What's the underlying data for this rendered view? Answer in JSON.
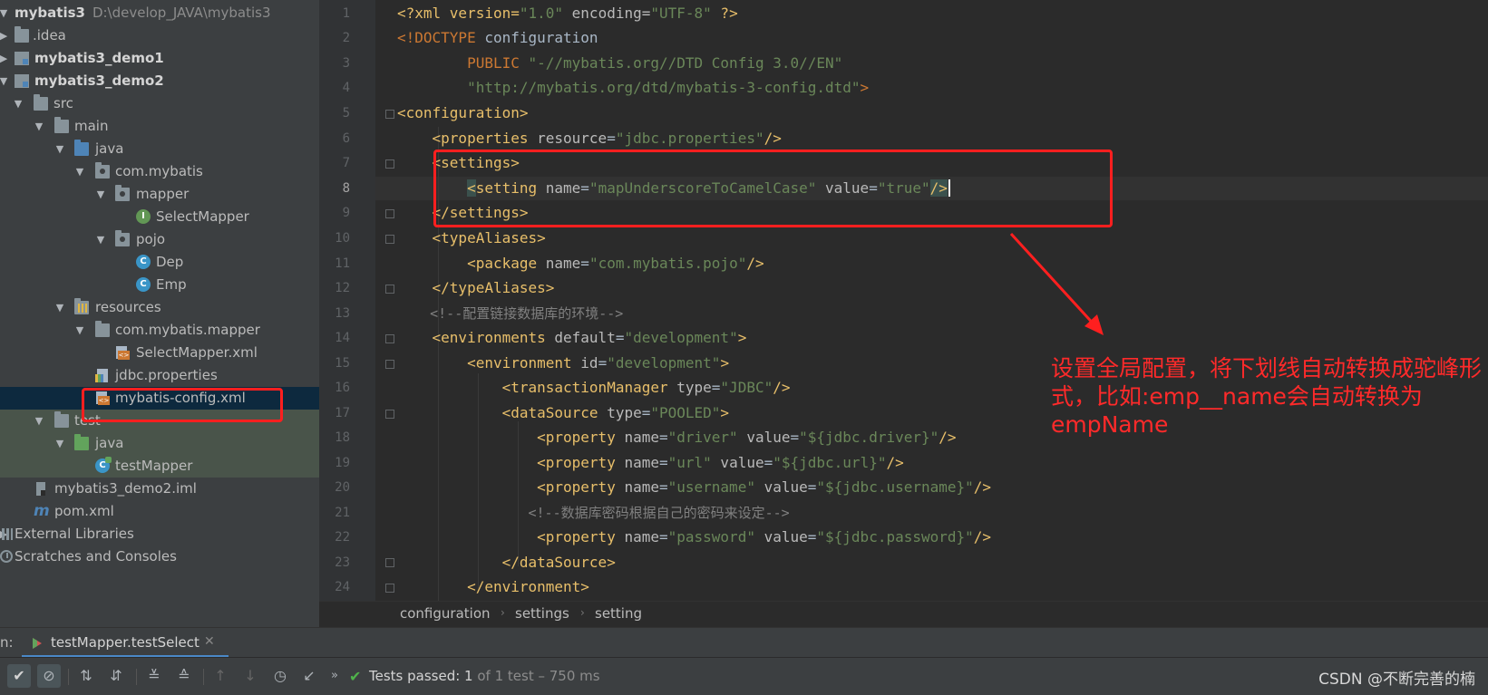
{
  "project_tree": {
    "root_name": "mybatis3",
    "root_path": "D:\\develop_JAVA\\mybatis3",
    "items": {
      "idea": ".idea",
      "demo1": "mybatis3_demo1",
      "demo2": "mybatis3_demo2",
      "src": "src",
      "main": "main",
      "java": "java",
      "com_mybatis": "com.mybatis",
      "mapper": "mapper",
      "select_mapper": "SelectMapper",
      "pojo": "pojo",
      "dep": "Dep",
      "emp": "Emp",
      "resources": "resources",
      "com_mybatis_mapper": "com.mybatis.mapper",
      "select_mapper_xml": "SelectMapper.xml",
      "jdbc_properties": "jdbc.properties",
      "mybatis_config": "mybatis-config.xml",
      "test": "test",
      "test_java": "java",
      "test_mapper": "testMapper",
      "iml": "mybatis3_demo2.iml",
      "pom": "pom.xml",
      "external_libraries": "External Libraries",
      "scratches": "Scratches and Consoles"
    }
  },
  "editor": {
    "line_numbers": [
      "1",
      "2",
      "3",
      "4",
      "5",
      "6",
      "7",
      "8",
      "9",
      "10",
      "11",
      "12",
      "13",
      "14",
      "15",
      "16",
      "17",
      "18",
      "19",
      "20",
      "21",
      "22",
      "23",
      "24"
    ],
    "current_line": "8",
    "lines": {
      "l1a": "<?xml version=",
      "l1b": "\"1.0\"",
      "l1c": " encoding=",
      "l1d": "\"UTF-8\"",
      "l1e": " ?>",
      "l2a": "<!DOCTYPE ",
      "l2b": "configuration",
      "l3a": "        PUBLIC ",
      "l3b": "\"-//mybatis.org//DTD Config 3.0//EN\"",
      "l4a": "        \"http://mybatis.org/dtd/mybatis-3-config.dtd\"",
      "l4b": ">",
      "l5": "<configuration>",
      "l6a": "    <properties ",
      "l6b": "resource",
      "l6c": "=",
      "l6d": "\"jdbc.properties\"",
      "l6e": "/>",
      "l7": "    <settings>",
      "l8a": "        ",
      "l8b": "<",
      "l8c": "setting ",
      "l8d": "name",
      "l8e": "=",
      "l8f": "\"mapUnderscoreToCamelCase\"",
      "l8g": " value",
      "l8h": "=",
      "l8i": "\"true\"",
      "l8j": "/>",
      "l9": "    </settings>",
      "l10": "    <typeAliases>",
      "l11a": "        <package ",
      "l11b": "name",
      "l11c": "=",
      "l11d": "\"com.mybatis.pojo\"",
      "l11e": "/>",
      "l12": "    </typeAliases>",
      "l13": "    <!--配置链接数据库的环境-->",
      "l14a": "    <environments ",
      "l14b": "default",
      "l14c": "=",
      "l14d": "\"development\"",
      "l14e": ">",
      "l15a": "        <environment ",
      "l15b": "id",
      "l15c": "=",
      "l15d": "\"development\"",
      "l15e": ">",
      "l16a": "            <transactionManager ",
      "l16b": "type",
      "l16c": "=",
      "l16d": "\"JDBC\"",
      "l16e": "/>",
      "l17a": "            <dataSource ",
      "l17b": "type",
      "l17c": "=",
      "l17d": "\"POOLED\"",
      "l17e": ">",
      "l18a": "                <property ",
      "l18b": "name",
      "l18c": "=",
      "l18d": "\"driver\"",
      "l18e": " value",
      "l18f": "=",
      "l18g": "\"${jdbc.driver}\"",
      "l18h": "/>",
      "l19a": "                <property ",
      "l19b": "name",
      "l19c": "=",
      "l19d": "\"url\"",
      "l19e": " value",
      "l19f": "=",
      "l19g": "\"${jdbc.url}\"",
      "l19h": "/>",
      "l20a": "                <property ",
      "l20b": "name",
      "l20c": "=",
      "l20d": "\"username\"",
      "l20e": " value",
      "l20f": "=",
      "l20g": "\"${jdbc.username}\"",
      "l20h": "/>",
      "l21": "                <!--数据库密码根据自己的密码来设定-->",
      "l22a": "                <property ",
      "l22b": "name",
      "l22c": "=",
      "l22d": "\"password\"",
      "l22e": " value",
      "l22f": "=",
      "l22g": "\"${jdbc.password}\"",
      "l22h": "/>",
      "l23": "            </dataSource>",
      "l24": "        </environment>"
    }
  },
  "breadcrumb": [
    "configuration",
    "settings",
    "setting"
  ],
  "run_panel": {
    "label": "n:",
    "tab": "testMapper.testSelect",
    "status_prefix": "Tests passed: ",
    "status_count": "1",
    "status_suffix": " of 1 test – 750 ms"
  },
  "annotation": {
    "note": "设置全局配置，将下划线自动转换成驼峰形式，比如:emp__name会自动转换为empName"
  },
  "watermark": "CSDN @不断完善的楠",
  "colors": {
    "annotation_red": "#ff1f1f",
    "pass_green": "#4fb34b",
    "selection_bg": "#0d293e"
  }
}
